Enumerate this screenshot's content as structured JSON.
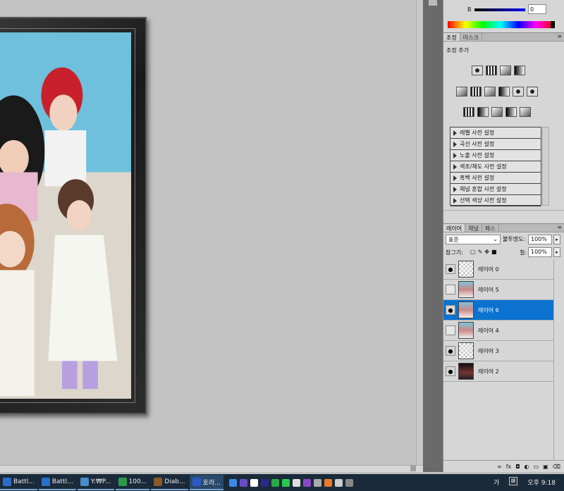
{
  "color_panel": {
    "channel_label": "B",
    "channel_value": "0"
  },
  "adjustments": {
    "tabs": [
      "조정",
      "마스크"
    ],
    "title": "조정 추가",
    "presets": [
      "레벨 사전 설정",
      "곡선 사전 설정",
      "노출 사전 설정",
      "색조/채도 사전 설정",
      "흑백 사전 설정",
      "채널 혼합 사전 설정",
      "선택 색상 사전 설정"
    ]
  },
  "layers_panel": {
    "tabs": [
      "레이어",
      "채널",
      "패스"
    ],
    "blend_mode": "표준",
    "opacity_label": "불투명도:",
    "opacity_value": "100%",
    "lock_label": "잠그기:",
    "fill_label": "칠:",
    "fill_value": "100%",
    "layers": [
      {
        "name": "레이어 0",
        "visible": true,
        "thumb": "empty"
      },
      {
        "name": "레이어 5",
        "visible": false,
        "thumb": "photo"
      },
      {
        "name": "레이어 6",
        "visible": true,
        "thumb": "photo",
        "selected": true
      },
      {
        "name": "레이어 4",
        "visible": false,
        "thumb": "photo"
      },
      {
        "name": "레이어 3",
        "visible": true,
        "thumb": "empty"
      },
      {
        "name": "레이어 2",
        "visible": true,
        "thumb": "dark"
      }
    ]
  },
  "taskbar": {
    "items": [
      {
        "label": "Battl...",
        "color": "#2a6ec8"
      },
      {
        "label": "Battl...",
        "color": "#2a6ec8"
      },
      {
        "label": "Y:₩P...",
        "color": "#4a8ac8"
      },
      {
        "label": "100...",
        "color": "#2a9a4a"
      },
      {
        "label": "Diab...",
        "color": "#8a5a2a"
      },
      {
        "label": "호라...",
        "color": "#2a5ac8"
      }
    ],
    "ime": "가",
    "ime2": "韓",
    "clock": "오후 9:18"
  }
}
